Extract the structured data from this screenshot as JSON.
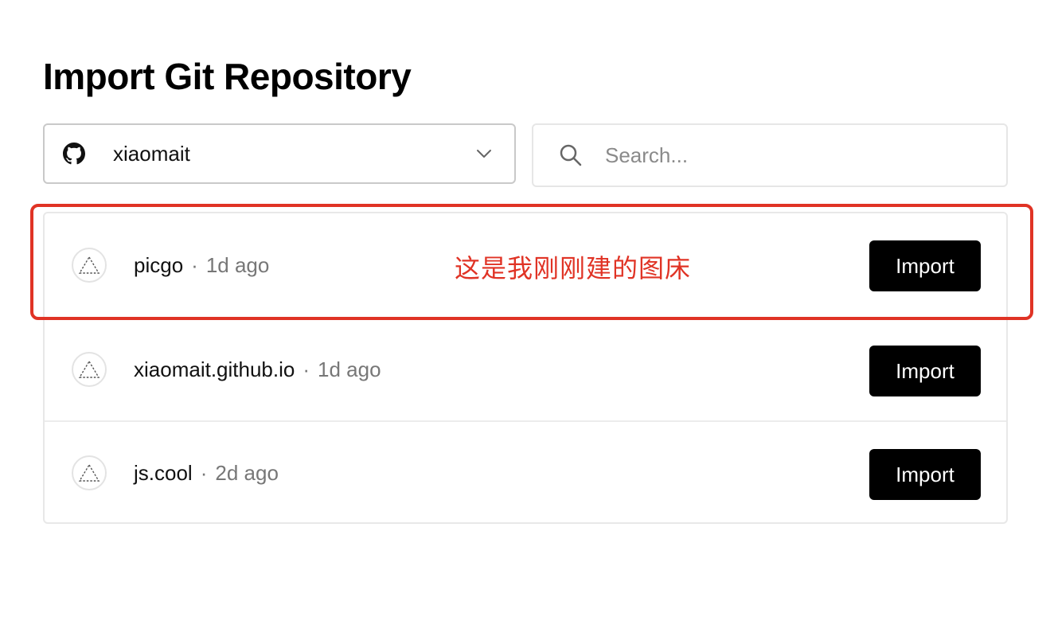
{
  "page": {
    "title": "Import Git Repository"
  },
  "account_selector": {
    "icon": "github-icon",
    "value": "xiaomait",
    "chevron_icon": "chevron-down-icon"
  },
  "search": {
    "icon": "search-icon",
    "placeholder": "Search...",
    "value": ""
  },
  "repositories": [
    {
      "name": "picgo",
      "separator": "·",
      "updated": "1d ago",
      "import_label": "Import",
      "avatar_icon": "vercel-triangle-icon"
    },
    {
      "name": "xiaomait.github.io",
      "separator": "·",
      "updated": "1d ago",
      "import_label": "Import",
      "avatar_icon": "vercel-triangle-icon"
    },
    {
      "name": "js.cool",
      "separator": "·",
      "updated": "2d ago",
      "import_label": "Import",
      "avatar_icon": "vercel-triangle-icon"
    }
  ],
  "annotation": {
    "text": "这是我刚刚建的图床",
    "color": "#e03325"
  },
  "colors": {
    "button_bg": "#000000",
    "button_text": "#ffffff",
    "muted_text": "#777777"
  }
}
